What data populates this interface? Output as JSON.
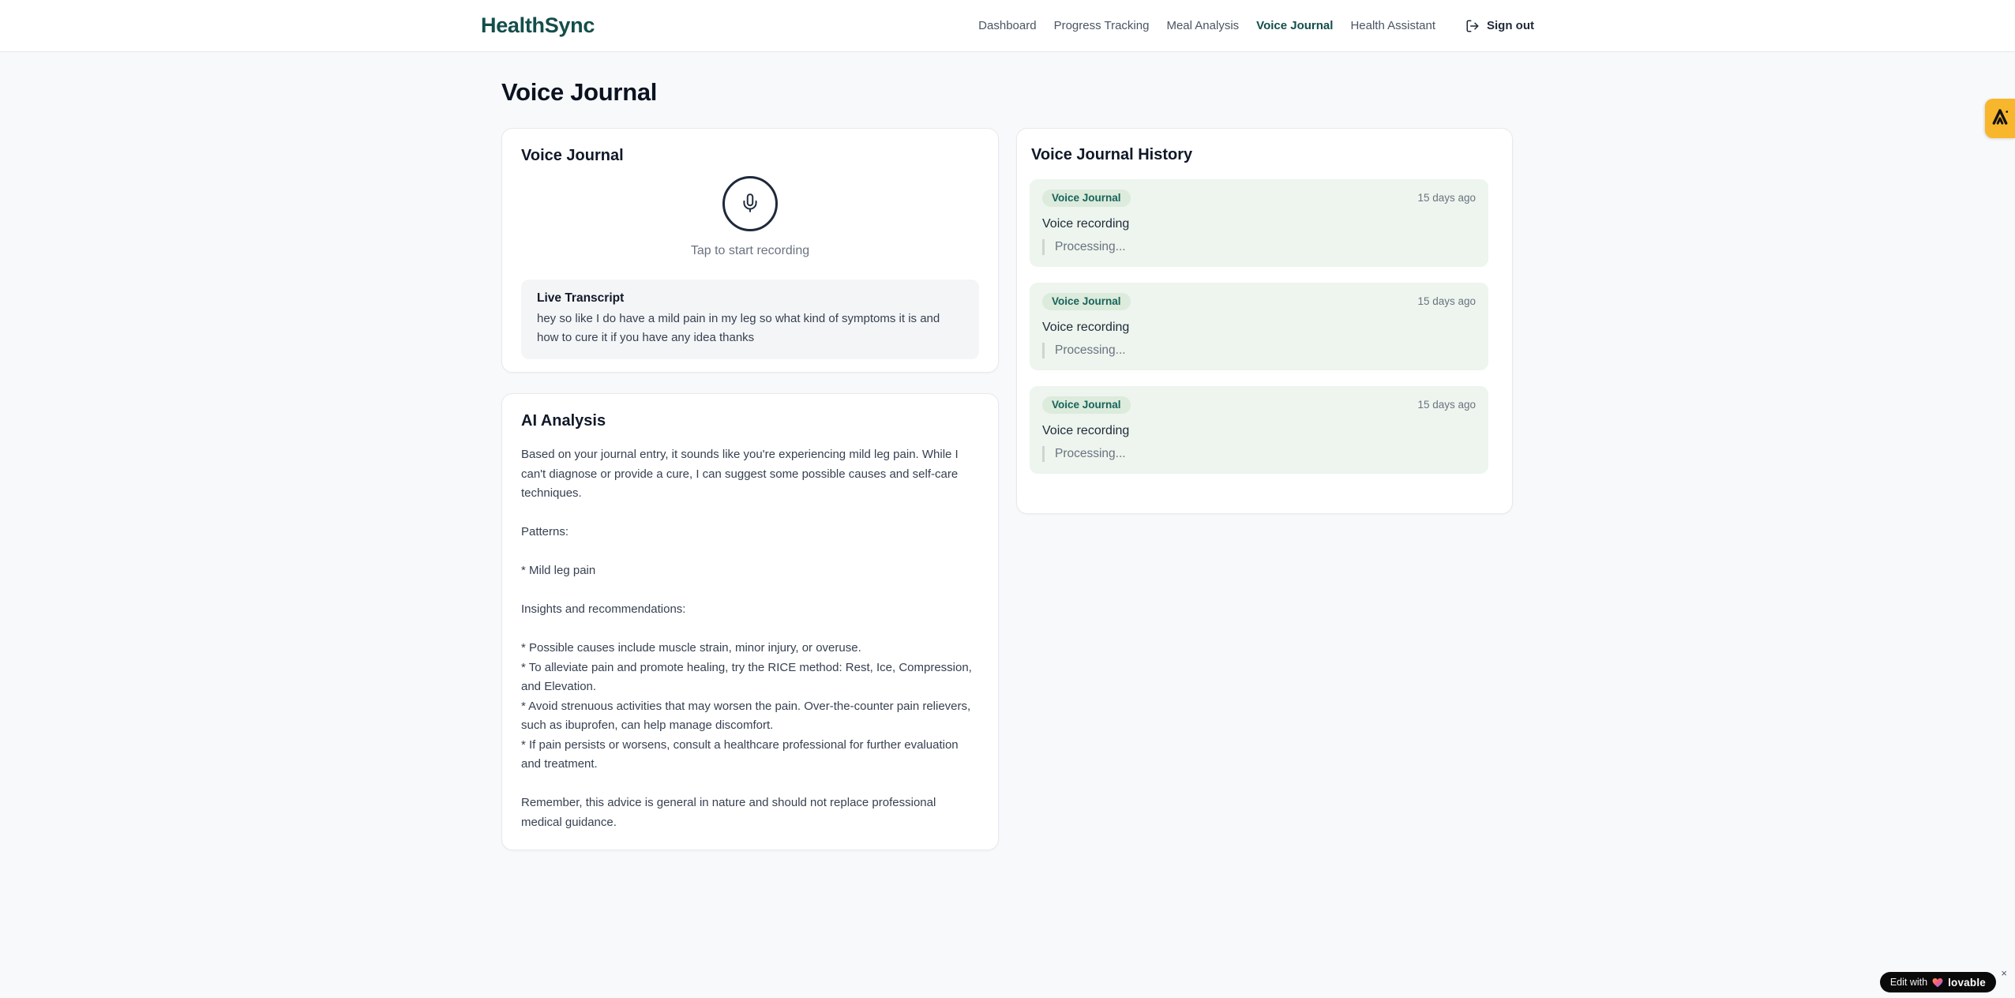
{
  "brand": {
    "name": "HealthSync"
  },
  "nav": {
    "items": [
      {
        "label": "Dashboard",
        "active": false
      },
      {
        "label": "Progress Tracking",
        "active": false
      },
      {
        "label": "Meal Analysis",
        "active": false
      },
      {
        "label": "Voice Journal",
        "active": true
      },
      {
        "label": "Health Assistant",
        "active": false
      }
    ],
    "sign_out_label": "Sign out"
  },
  "page": {
    "title": "Voice Journal"
  },
  "recorder": {
    "card_title": "Voice Journal",
    "tap_hint": "Tap to start recording",
    "transcript_title": "Live Transcript",
    "transcript_text": "hey so like I do have a mild pain in my leg so what kind of symptoms it is and how to cure it if you have any idea thanks"
  },
  "ai": {
    "card_title": "AI Analysis",
    "body": "Based on your journal entry, it sounds like you're experiencing mild leg pain. While I can't diagnose or provide a cure, I can suggest some possible causes and self-care techniques.\n\nPatterns:\n\n* Mild leg pain\n\nInsights and recommendations:\n\n* Possible causes include muscle strain, minor injury, or overuse.\n* To alleviate pain and promote healing, try the RICE method: Rest, Ice, Compression, and Elevation.\n* Avoid strenuous activities that may worsen the pain. Over-the-counter pain relievers, such as ibuprofen, can help manage discomfort.\n* If pain persists or worsens, consult a healthcare professional for further evaluation and treatment.\n\nRemember, this advice is general in nature and should not replace professional medical guidance."
  },
  "history": {
    "card_title": "Voice Journal History",
    "entries": [
      {
        "badge": "Voice Journal",
        "time": "15 days ago",
        "title": "Voice recording",
        "status": "Processing..."
      },
      {
        "badge": "Voice Journal",
        "time": "15 days ago",
        "title": "Voice recording",
        "status": "Processing..."
      },
      {
        "badge": "Voice Journal",
        "time": "15 days ago",
        "title": "Voice recording",
        "status": "Processing..."
      }
    ]
  },
  "lovable": {
    "prefix": "Edit with",
    "brand": "lovable",
    "close": "×"
  },
  "colors": {
    "brand_teal": "#134e4a",
    "page_background": "#f8f9fb",
    "entry_background": "#edf5ee",
    "entry_badge_background": "#dcebdc",
    "entry_badge_text": "#17635a",
    "side_tab_amber": "#f8b62d",
    "mic_ring": "#1e293b"
  }
}
